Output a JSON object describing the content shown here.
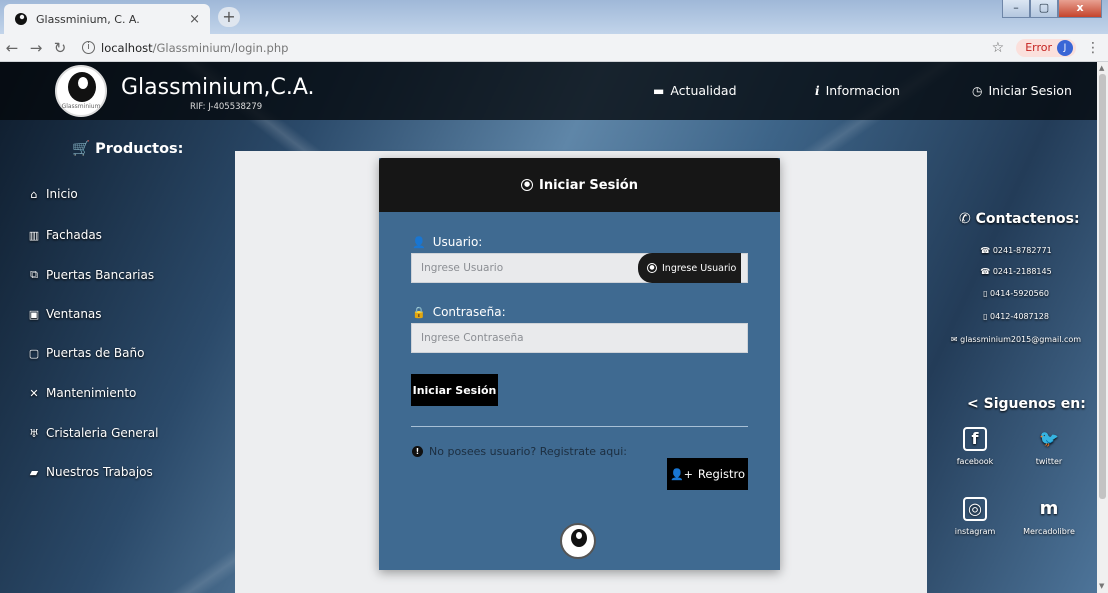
{
  "browser": {
    "tab_title": "Glassminium, C. A.",
    "tab_close": "×",
    "new_tab": "+",
    "url_host": "localhost",
    "url_path": "/Glassminium/login.php",
    "error_label": "Error",
    "profile_initial": "J"
  },
  "navbar": {
    "brand": "Glassminium,C.A.",
    "rif": "RIF: J-405538279",
    "logo_text": "Glassminium",
    "items": [
      {
        "label": "Actualidad",
        "icon": "calendar-icon"
      },
      {
        "label": "Informacion",
        "icon": "info-icon"
      },
      {
        "label": "Iniciar Sesion",
        "icon": "clock-icon"
      }
    ]
  },
  "sidebar": {
    "title": "Productos:",
    "items": [
      {
        "label": "Inicio",
        "icon": "home-icon"
      },
      {
        "label": "Fachadas",
        "icon": "building-icon"
      },
      {
        "label": "Puertas Bancarias",
        "icon": "copy-icon"
      },
      {
        "label": "Ventanas",
        "icon": "window-icon"
      },
      {
        "label": "Puertas de Baño",
        "icon": "square-icon"
      },
      {
        "label": "Mantenimiento",
        "icon": "tools-icon"
      },
      {
        "label": "Cristaleria General",
        "icon": "glass-icon"
      },
      {
        "label": "Nuestros Trabajos",
        "icon": "briefcase-icon"
      }
    ]
  },
  "login": {
    "title": "Iniciar Sesión",
    "user_label": "Usuario:",
    "user_placeholder": "Ingrese Usuario",
    "user_value": "",
    "user_tooltip": "Ingrese Usuario",
    "pass_label": "Contraseña:",
    "pass_placeholder": "Ingrese Contraseña",
    "pass_value": "",
    "submit_label": "Iniciar Sesión",
    "register_note": "No posees usuario? Registrate aqui:",
    "register_label": "Registro",
    "logo_text": "Glassminium"
  },
  "contact": {
    "title": "Contactenos:",
    "phones": [
      "0241-8782771",
      "0241-2188145",
      "0414-5920560",
      "0412-4087128"
    ],
    "email": "glassminium2015@gmail.com"
  },
  "social": {
    "title": "Siguenos en:",
    "items": [
      {
        "label": "facebook",
        "glyph": "f"
      },
      {
        "label": "twitter",
        "glyph": "🐦"
      },
      {
        "label": "instagram",
        "glyph": "◎"
      },
      {
        "label": "Mercadolibre",
        "glyph": "m"
      }
    ]
  },
  "colors": {
    "navbar_bg": "#04080c",
    "card_bg": "#3f6a91",
    "card_header": "#161616",
    "content_bg": "#edeef0",
    "button_bg": "#000000"
  }
}
